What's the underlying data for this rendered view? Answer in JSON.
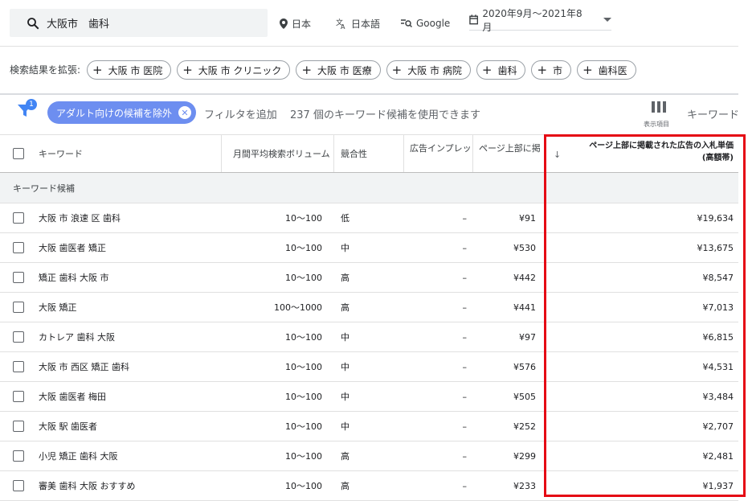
{
  "search": {
    "query": "大阪市　歯科"
  },
  "top": {
    "location": "日本",
    "language": "日本語",
    "network": "Google",
    "date_range": "2020年9月〜2021年8月"
  },
  "expand": {
    "label": "検索結果を拡張:",
    "chips": [
      "大阪 市 医院",
      "大阪 市 クリニック",
      "大阪 市 医療",
      "大阪 市 病院",
      "歯科",
      "市",
      "歯科医"
    ]
  },
  "filter": {
    "badge": "1",
    "pill_label": "アダルト向けの候補を除外",
    "add_filter": "フィルタを追加",
    "count_text": "237 個のキーワード候補を使用できます",
    "columns_label": "表示項目",
    "keyword_tab": "キーワード"
  },
  "table": {
    "headers": {
      "keyword": "キーワード",
      "volume": "月間平均検索ボリューム",
      "competition": "競合性",
      "impression": "広告インプレッ",
      "low_bid": "ページ上部に掲",
      "high_bid_line1": "ページ上部に掲載された広告の入札単価",
      "high_bid_line2": "(高額帯)"
    },
    "group_label": "キーワード候補",
    "rows": [
      {
        "keyword": "大阪 市 浪速 区 歯科",
        "volume": "10〜100",
        "competition": "低",
        "impression": "–",
        "low_bid": "¥91",
        "high_bid": "¥19,634"
      },
      {
        "keyword": "大阪 歯医者 矯正",
        "volume": "10〜100",
        "competition": "中",
        "impression": "–",
        "low_bid": "¥530",
        "high_bid": "¥13,675"
      },
      {
        "keyword": "矯正 歯科 大阪 市",
        "volume": "10〜100",
        "competition": "高",
        "impression": "–",
        "low_bid": "¥442",
        "high_bid": "¥8,547"
      },
      {
        "keyword": "大阪 矯正",
        "volume": "100〜1000",
        "competition": "高",
        "impression": "–",
        "low_bid": "¥441",
        "high_bid": "¥7,013"
      },
      {
        "keyword": "カトレア 歯科 大阪",
        "volume": "10〜100",
        "competition": "中",
        "impression": "–",
        "low_bid": "¥97",
        "high_bid": "¥6,815"
      },
      {
        "keyword": "大阪 市 西区 矯正 歯科",
        "volume": "10〜100",
        "competition": "中",
        "impression": "–",
        "low_bid": "¥576",
        "high_bid": "¥4,531"
      },
      {
        "keyword": "大阪 歯医者 梅田",
        "volume": "10〜100",
        "competition": "中",
        "impression": "–",
        "low_bid": "¥505",
        "high_bid": "¥3,484"
      },
      {
        "keyword": "大阪 駅 歯医者",
        "volume": "10〜100",
        "competition": "中",
        "impression": "–",
        "low_bid": "¥252",
        "high_bid": "¥2,707"
      },
      {
        "keyword": "小児 矯正 歯科 大阪",
        "volume": "10〜100",
        "competition": "高",
        "impression": "–",
        "low_bid": "¥299",
        "high_bid": "¥2,481"
      },
      {
        "keyword": "審美 歯科 大阪 おすすめ",
        "volume": "10〜100",
        "competition": "高",
        "impression": "–",
        "low_bid": "¥233",
        "high_bid": "¥1,937"
      }
    ]
  },
  "colors": {
    "highlight": "#e50914",
    "pill": "#6d8ef0",
    "badge": "#4285f4"
  }
}
